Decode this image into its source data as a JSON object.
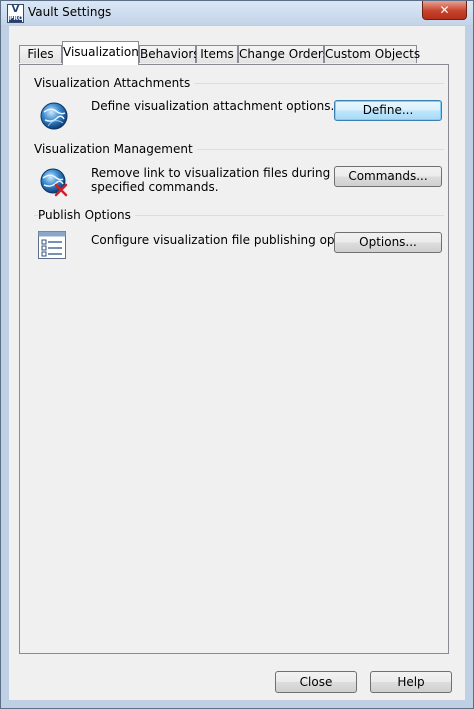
{
  "window": {
    "title": "Vault Settings",
    "icon": "vault-app-icon",
    "close_glyph": "✕"
  },
  "tabs": [
    {
      "label": "Files"
    },
    {
      "label": "Visualization"
    },
    {
      "label": "Behaviors"
    },
    {
      "label": "Items"
    },
    {
      "label": "Change Orders"
    },
    {
      "label": "Custom Objects"
    }
  ],
  "active_tab": "Visualization",
  "groups": {
    "attachments": {
      "title": "Visualization Attachments",
      "description": "Define visualization attachment options.",
      "button": "Define...",
      "icon": "globe-icon"
    },
    "management": {
      "title": "Visualization Management",
      "description_line1": "Remove link to visualization files during",
      "description_line2": "specified commands.",
      "button": "Commands...",
      "icon": "globe-remove-icon"
    },
    "publish": {
      "title": "Publish Options",
      "description": "Configure visualization file publishing options.",
      "button": "Options...",
      "icon": "checklist-icon"
    }
  },
  "footer": {
    "close_label": "Close",
    "help_label": "Help"
  },
  "colors": {
    "close_button": "#c7432c",
    "default_button_border": "#3c7fb1",
    "title_bar": "#c3d4e9"
  }
}
